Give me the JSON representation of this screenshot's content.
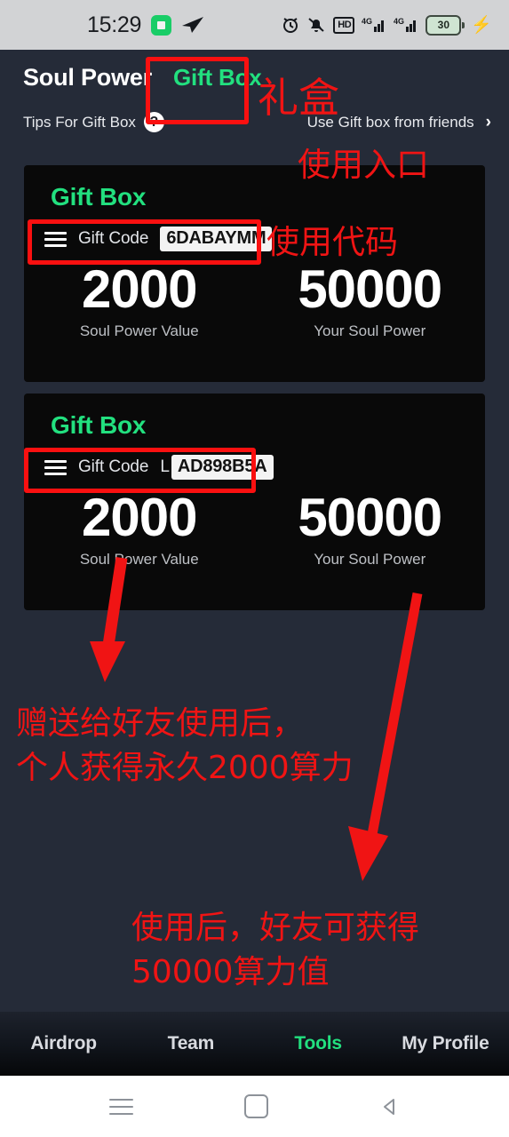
{
  "status_bar": {
    "time": "15:29",
    "left_icons": [
      "green-app-icon",
      "telegram-send-icon"
    ],
    "right_icons": [
      "alarm-icon",
      "bell-muted-icon",
      "hd-icon",
      "signal-4g-icon",
      "signal-4g-icon-2"
    ],
    "hd_label": "HD",
    "signal_label_1": "4G",
    "signal_label_2": "4G",
    "battery_level": "30",
    "charging": true
  },
  "header": {
    "app_title": "Soul Power",
    "tab_label": "Gift Box",
    "tips_label": "Tips For Gift Box",
    "help_badge": "?",
    "friends_link": "Use Gift box from friends",
    "chevron": "›"
  },
  "cards": [
    {
      "title": "Gift Box",
      "code_label": "Gift Code",
      "code_prefix": "",
      "code_value": "6DABAYMM",
      "stats": [
        {
          "value": "2000",
          "label": "Soul Power Value"
        },
        {
          "value": "50000",
          "label": "Your Soul Power"
        }
      ]
    },
    {
      "title": "Gift Box",
      "code_label": "Gift Code",
      "code_prefix": "L",
      "code_value": "AD898B5A",
      "stats": [
        {
          "value": "2000",
          "label": "Soul Power Value"
        },
        {
          "value": "50000",
          "label": "Your Soul Power"
        }
      ]
    }
  ],
  "annotations": {
    "color": "#f01414",
    "gift_box_label": "礼盒",
    "entry_label": "使用入口",
    "use_code_label": "使用代码",
    "note_left_line1": "赠送给好友使用后，",
    "note_left_line2": "个人获得永久2000算力",
    "note_right_line1": "使用后，好友可获得",
    "note_right_line2": "50000算力值"
  },
  "bottom_nav": {
    "items": [
      {
        "label": "Airdrop",
        "active": false
      },
      {
        "label": "Team",
        "active": false
      },
      {
        "label": "Tools",
        "active": true
      },
      {
        "label": "My Profile",
        "active": false
      }
    ],
    "active_color": "#22e07f"
  },
  "system_bar": {
    "buttons": [
      "menu-icon",
      "home-icon",
      "back-icon"
    ]
  }
}
